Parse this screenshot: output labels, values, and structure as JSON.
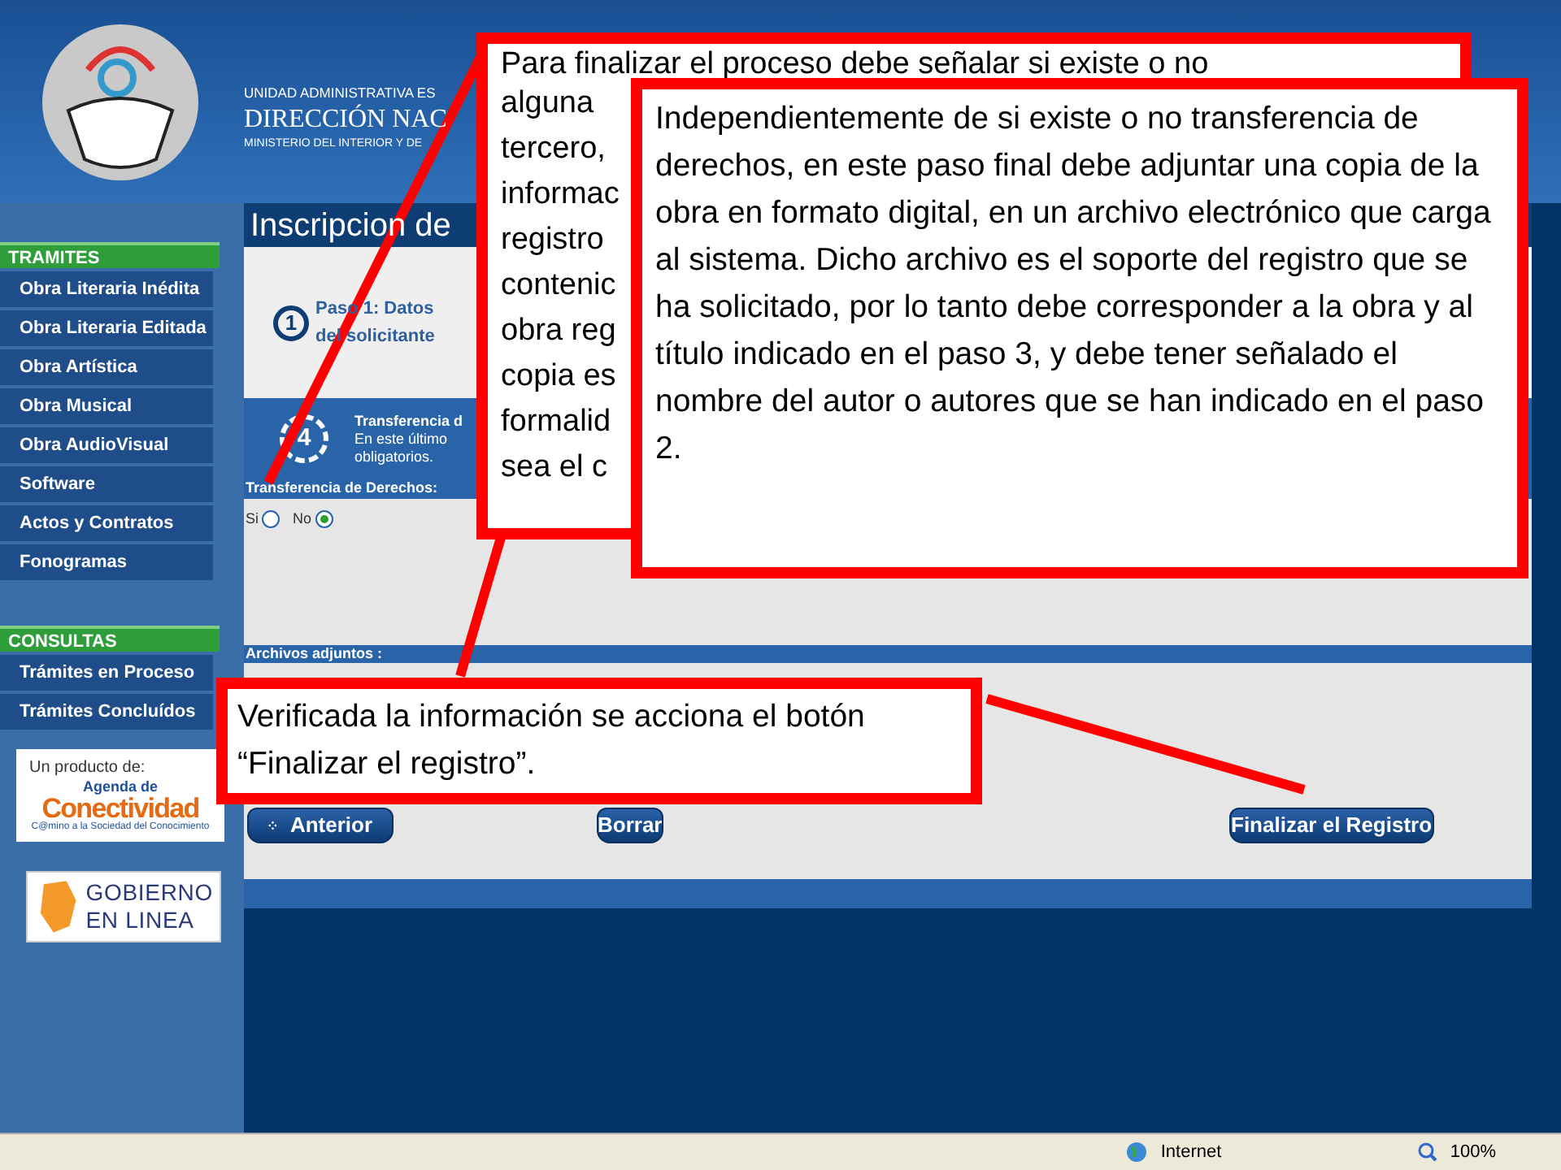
{
  "header": {
    "lines": [
      "UNIDAD ADMINISTRATIVA ES",
      "DIRECCIÓN NAC",
      "MINISTERIO DEL INTERIOR Y DE"
    ]
  },
  "sidebar": {
    "sections": [
      {
        "title": "TRAMITES",
        "items": [
          {
            "label": "Obra Literaria Inédita"
          },
          {
            "label": "Obra Literaria Editada"
          },
          {
            "label": "Obra Artística"
          },
          {
            "label": "Obra Musical"
          },
          {
            "label": "Obra AudioVisual"
          },
          {
            "label": "Software"
          },
          {
            "label": "Actos y Contratos"
          },
          {
            "label": "Fonogramas"
          }
        ]
      },
      {
        "title": "CONSULTAS",
        "items": [
          {
            "label": "Trámites en Proceso"
          },
          {
            "label": "Trámites Concluídos"
          }
        ]
      }
    ],
    "partners": [
      {
        "kind": "conectividad",
        "lines": [
          "Un producto de:",
          "Agenda de",
          "Conectividad",
          "C@mino a la Sociedad del Conocimiento"
        ]
      },
      {
        "kind": "gobierno",
        "lines": [
          "GOBIERNO",
          "EN LINEA"
        ]
      }
    ]
  },
  "content": {
    "title": "Inscripcion de",
    "step_current": {
      "number": "1",
      "lines": [
        "Paso 1: Datos",
        "del solicitante"
      ]
    },
    "step_final": {
      "number": "4",
      "lines": [
        "Transferencia d",
        "En este último",
        "obligatorios."
      ]
    },
    "field": {
      "label": "Transferencia de Derechos:",
      "options": [
        {
          "label": "Si",
          "selected": false
        },
        {
          "label": "No",
          "selected": true
        }
      ]
    },
    "attachments": {
      "heading": "Archivos adjuntos :"
    },
    "buttons": [
      {
        "label": "Anterior",
        "kind": "back"
      },
      {
        "label": "Borrar",
        "kind": "plain"
      },
      {
        "label": "Finalizar el Registro",
        "kind": "plain"
      }
    ]
  },
  "callouts": [
    {
      "lines": [
        "Para finalizar el proceso debe señalar si existe o no",
        "alguna",
        "tercero,",
        "informac",
        "registro",
        "contenic",
        "obra reg",
        "copia es",
        "formalid",
        "sea el c"
      ]
    },
    {
      "text": "Independientemente de si existe o no transferencia de derechos, en este paso final debe adjuntar una copia de la obra en formato digital, en un archivo electrónico que carga al sistema. Dicho archivo es el soporte del registro que se ha solicitado, por lo tanto debe corresponder a la obra y al título indicado en el paso 3, y debe tener señalado el nombre del autor o autores que se han indicado en el paso 2."
    },
    {
      "text": "Verificada la información se acciona el botón “Finalizar el registro”."
    }
  ],
  "status_bar": {
    "zone": "Internet",
    "zoom": "100%"
  }
}
